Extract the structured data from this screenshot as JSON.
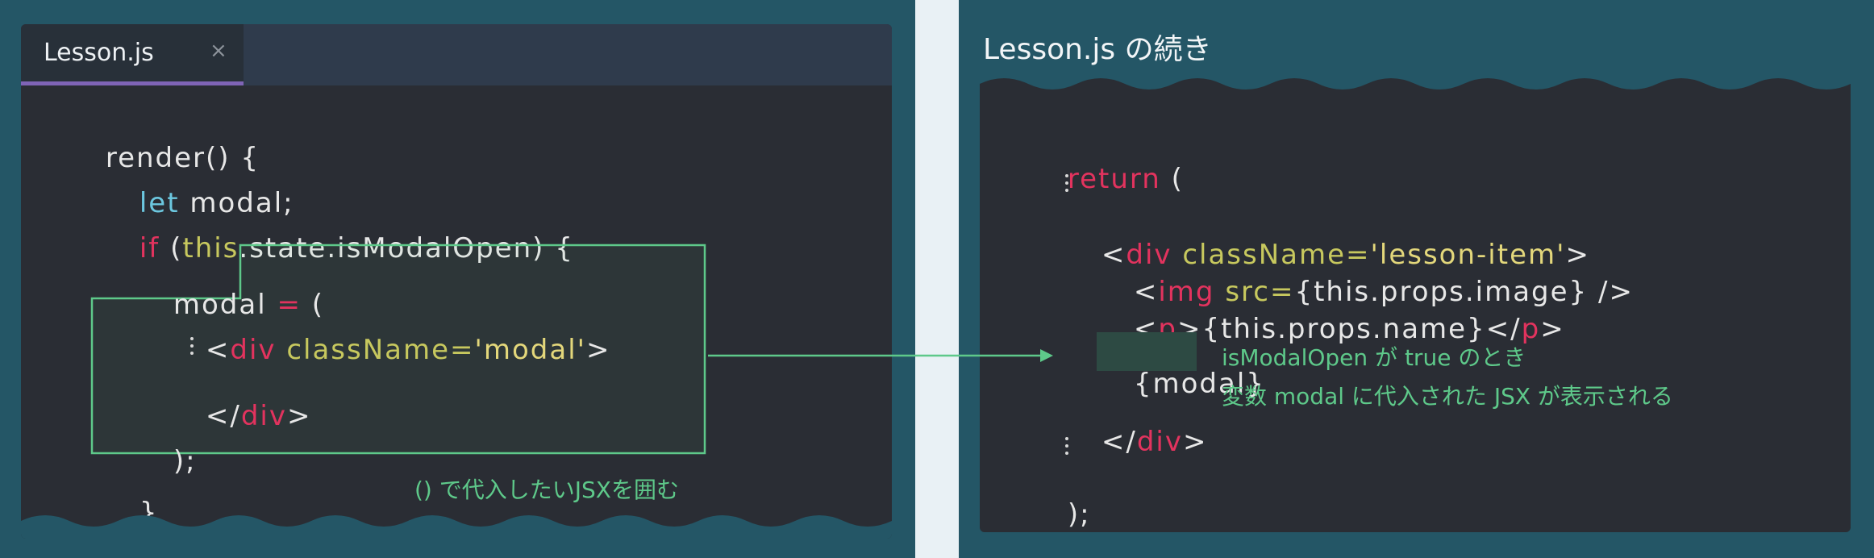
{
  "left": {
    "tab": {
      "label": "Lesson.js",
      "close": "×"
    },
    "code": {
      "l1": "render() {",
      "l2_kw": "let",
      "l2_rest": " modal;",
      "l3_if": "if",
      "l3_open": " (",
      "l3_this": "this",
      "l3_rest": ".state.isModalOpen) {",
      "l4_a": "modal ",
      "l4_eq": "=",
      "l4_paren": " (",
      "l5_lt": "<",
      "l5_div": "div",
      "l5_attr": " className=",
      "l5_str": "'modal'",
      "l5_gt": ">",
      "l6_lt": "</",
      "l6_div": "div",
      "l6_gt": ">",
      "l7": ");",
      "l8": "}"
    },
    "note": "() で代入したいJSXを囲む"
  },
  "right": {
    "title": "Lesson.js の続き",
    "code": {
      "r1_kw": "return",
      "r1_rest": " (",
      "r2_lt": "<",
      "r2_div": "div",
      "r2_attr": " className=",
      "r2_str": "'lesson-item'",
      "r2_gt": ">",
      "r3_lt": "<",
      "r3_img": "img",
      "r3_src": " src=",
      "r3_rest": "{this.props.image} />",
      "r4_lt": "<",
      "r4_p": "p",
      "r4_mid": ">{this.props.name}</",
      "r4_p2": "p",
      "r4_gt": ">",
      "r5_open": "{",
      "r5_modal": "modal",
      "r5_close": "}",
      "r6_lt": "</",
      "r6_div": "div",
      "r6_gt": ">",
      "r7": ");"
    },
    "note1": "isModalOpen が true のとき",
    "note2": "変数 modal に代入された JSX が表示される"
  },
  "colors": {
    "background": "#245666",
    "editor": "#2a2d34",
    "keyword": "#e2335e",
    "let": "#6cc7df",
    "attribute": "#c7c85e",
    "string": "#e3d77b",
    "highlight": "#5ec98a",
    "tab_accent": "#7f64b6"
  }
}
